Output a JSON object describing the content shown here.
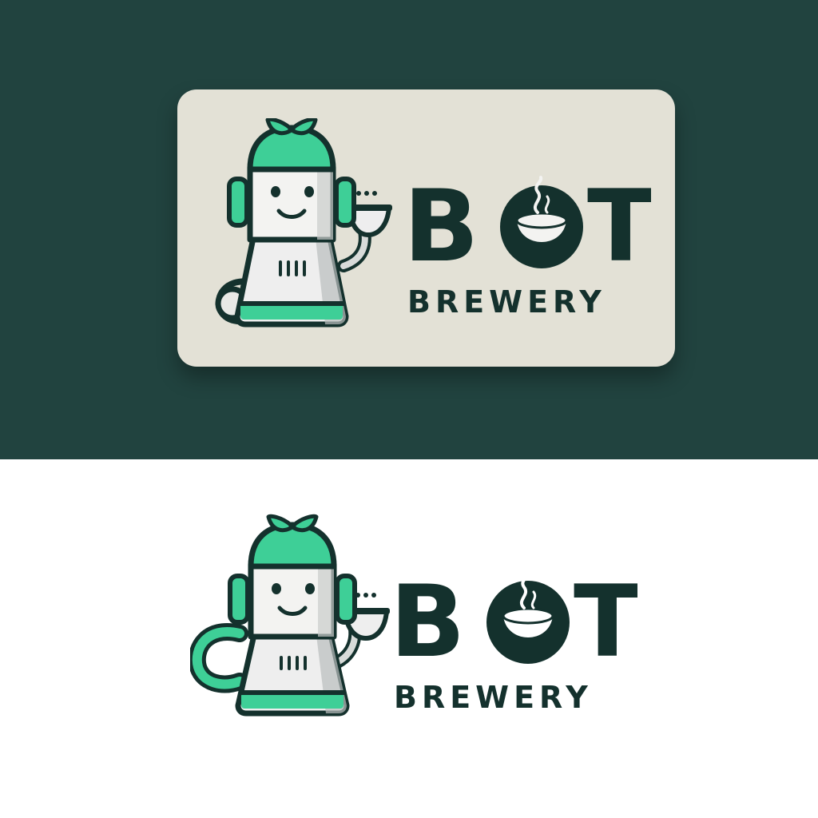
{
  "brand": {
    "name_primary_b": "B",
    "name_primary_t": "T",
    "name_secondary": "BREWERY"
  },
  "colors": {
    "dark_teal_background": "#21433f",
    "card_background": "#e3e1d6",
    "white_background": "#ffffff",
    "mint_green": "#3ecf97",
    "ink": "#14312d",
    "metal_light": "#eeeeee",
    "metal_shade": "#b9bdbd"
  },
  "icons": [
    "robot-kettle-mascot-icon",
    "leaf-sprout-icon",
    "steaming-coffee-cup-icon",
    "cup-held-icon"
  ]
}
